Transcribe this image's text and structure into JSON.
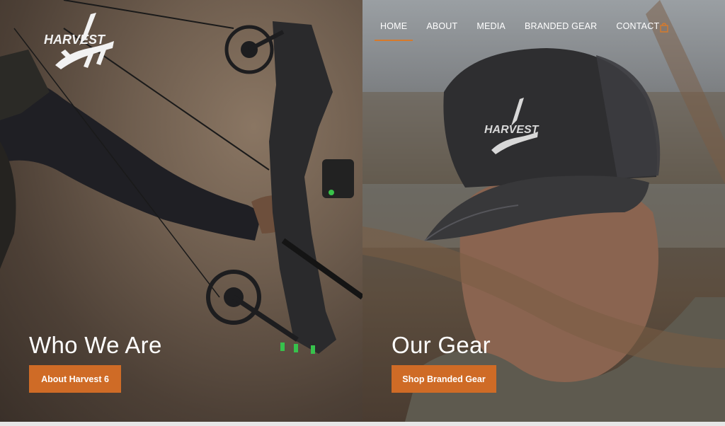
{
  "brand": {
    "logo_text": "HARVEST"
  },
  "nav": {
    "items": [
      {
        "label": "HOME",
        "active": true
      },
      {
        "label": "ABOUT",
        "active": false
      },
      {
        "label": "MEDIA",
        "active": false
      },
      {
        "label": "BRANDED GEAR",
        "active": false
      },
      {
        "label": "CONTACT",
        "active": false
      }
    ],
    "cart_icon": "cart-icon"
  },
  "left": {
    "title": "Who We Are",
    "button": "About Harvest 6"
  },
  "right": {
    "title": "Our Gear",
    "button": "Shop Branded Gear",
    "hat_logo_text": "HARVEST"
  },
  "colors": {
    "accent": "#cf6b26",
    "nav_underline": "#d67a2c",
    "text": "#ffffff"
  }
}
